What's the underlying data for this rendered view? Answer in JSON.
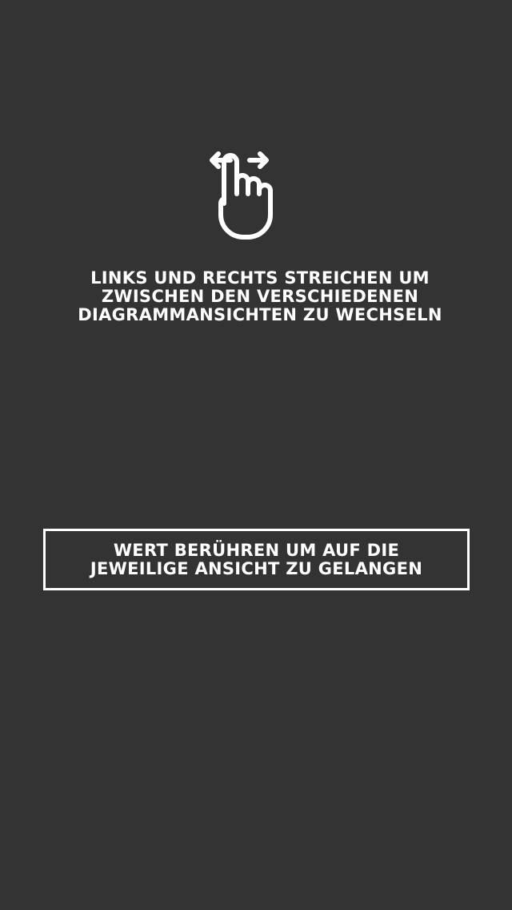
{
  "onboarding": {
    "swipe_hint_text": "Links und rechts streichen um zwischen den verschiedenen Diagrammansichten zu wechseln",
    "tap_hint_text": "Wert berühren um auf die jeweilige Ansicht zu gelangen",
    "swipe_icon": "swipe-left-right-hand-icon"
  },
  "colors": {
    "background": "#333333",
    "foreground": "#ffffff"
  }
}
